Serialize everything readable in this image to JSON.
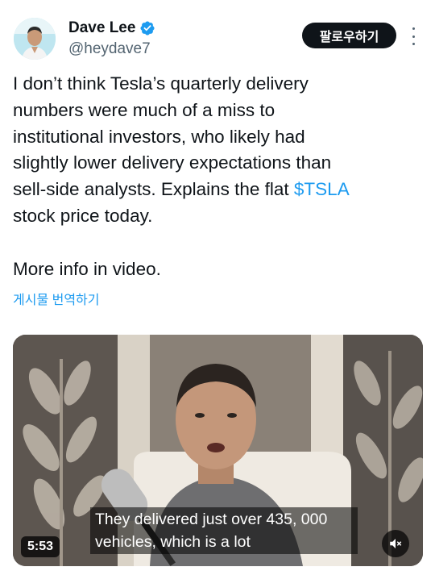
{
  "author": {
    "display_name": "Dave Lee",
    "handle": "@heydave7",
    "verified_icon": "verified-badge-icon",
    "avatar_icon": "avatar-image"
  },
  "actions": {
    "follow_label": "팔로우하기",
    "more_icon": "more-options-icon"
  },
  "tweet": {
    "text_before_cashtag": "I don’t think Tesla’s quarterly delivery\nnumbers were much of a miss to\ninstitutional investors, who likely had\nslightly lower delivery expectations than\nsell-side analysts. Explains the flat ",
    "cashtag": "$TSLA",
    "text_after_cashtag": "\nstock price today.\n\nMore info in video.",
    "translate_label": "게시물 번역하기"
  },
  "video": {
    "caption_line1": "They delivered just over 435, 000",
    "caption_line2": "vehicles, which is a lot",
    "duration": "5:53",
    "mute_icon": "muted-speaker-icon"
  },
  "colors": {
    "link": "#1d9bf0",
    "text": "#0f1419",
    "secondary": "#536471",
    "button_bg": "#0f1419"
  }
}
